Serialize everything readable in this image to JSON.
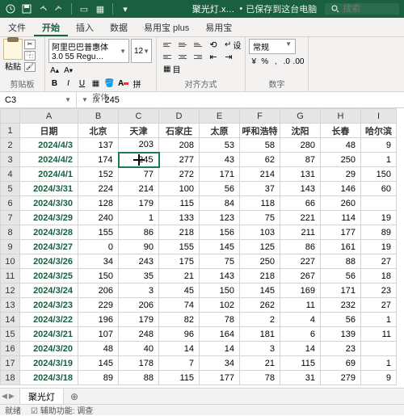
{
  "titlebar": {
    "filename": "聚光灯.x…",
    "status": "已保存到这台电脑",
    "search_placeholder": "搜索"
  },
  "tabs": [
    "文件",
    "开始",
    "插入",
    "数据",
    "易用宝 plus",
    "易用宝"
  ],
  "active_tab": 1,
  "ribbon": {
    "clipboard_label": "剪贴板",
    "paste_label": "粘贴",
    "font_label": "字体",
    "font_name": "阿里巴巴普惠体 3.0 55 Regu…",
    "font_size": "12",
    "align_label": "对齐方式",
    "wrap_text": "设",
    "merge_text": "目",
    "number_label": "数字",
    "number_format": "常规"
  },
  "cell_ref": "C3",
  "formula_value": "245",
  "columns": [
    "A",
    "B",
    "C",
    "D",
    "E",
    "F",
    "G",
    "H",
    "I"
  ],
  "headers": [
    "日期",
    "北京",
    "天津",
    "石家庄",
    "太原",
    "呼和浩特",
    "沈阳",
    "长春",
    "哈尔滨"
  ],
  "rows": [
    {
      "n": 1
    },
    {
      "n": 2,
      "date": "2024/4/3",
      "v": [
        137,
        203,
        208,
        53,
        58,
        280,
        48,
        "9"
      ]
    },
    {
      "n": 3,
      "date": "2024/4/2",
      "v": [
        174,
        245,
        277,
        43,
        62,
        87,
        250,
        "1"
      ]
    },
    {
      "n": 4,
      "date": "2024/4/1",
      "v": [
        152,
        77,
        272,
        171,
        214,
        131,
        29,
        "150"
      ]
    },
    {
      "n": 5,
      "date": "2024/3/31",
      "v": [
        224,
        214,
        100,
        56,
        37,
        143,
        146,
        "60"
      ]
    },
    {
      "n": 6,
      "date": "2024/3/30",
      "v": [
        128,
        179,
        115,
        84,
        118,
        66,
        260,
        ""
      ]
    },
    {
      "n": 7,
      "date": "2024/3/29",
      "v": [
        240,
        1,
        133,
        123,
        75,
        221,
        114,
        "19"
      ]
    },
    {
      "n": 8,
      "date": "2024/3/28",
      "v": [
        155,
        86,
        218,
        156,
        103,
        211,
        177,
        "89"
      ]
    },
    {
      "n": 9,
      "date": "2024/3/27",
      "v": [
        0,
        90,
        155,
        145,
        125,
        86,
        161,
        "19"
      ]
    },
    {
      "n": 10,
      "date": "2024/3/26",
      "v": [
        34,
        243,
        175,
        75,
        250,
        227,
        88,
        "27"
      ]
    },
    {
      "n": 11,
      "date": "2024/3/25",
      "v": [
        150,
        35,
        21,
        143,
        218,
        267,
        56,
        "18"
      ]
    },
    {
      "n": 12,
      "date": "2024/3/24",
      "v": [
        206,
        3,
        45,
        150,
        145,
        169,
        171,
        "23"
      ]
    },
    {
      "n": 13,
      "date": "2024/3/23",
      "v": [
        229,
        206,
        74,
        102,
        262,
        11,
        232,
        "27"
      ]
    },
    {
      "n": 14,
      "date": "2024/3/22",
      "v": [
        196,
        179,
        82,
        78,
        2,
        4,
        56,
        "1"
      ]
    },
    {
      "n": 15,
      "date": "2024/3/21",
      "v": [
        107,
        248,
        96,
        164,
        181,
        6,
        139,
        "11"
      ]
    },
    {
      "n": 16,
      "date": "2024/3/20",
      "v": [
        48,
        40,
        14,
        14,
        3,
        14,
        23,
        ""
      ]
    },
    {
      "n": 17,
      "date": "2024/3/19",
      "v": [
        145,
        178,
        7,
        34,
        21,
        115,
        69,
        "1"
      ]
    },
    {
      "n": 18,
      "date": "2024/3/18",
      "v": [
        89,
        88,
        115,
        177,
        78,
        31,
        279,
        "9"
      ]
    }
  ],
  "selected": {
    "row": 3,
    "col": "C"
  },
  "sheet_name": "聚光灯",
  "status": {
    "ready": "就绪",
    "acc": "辅助功能: 调查"
  }
}
